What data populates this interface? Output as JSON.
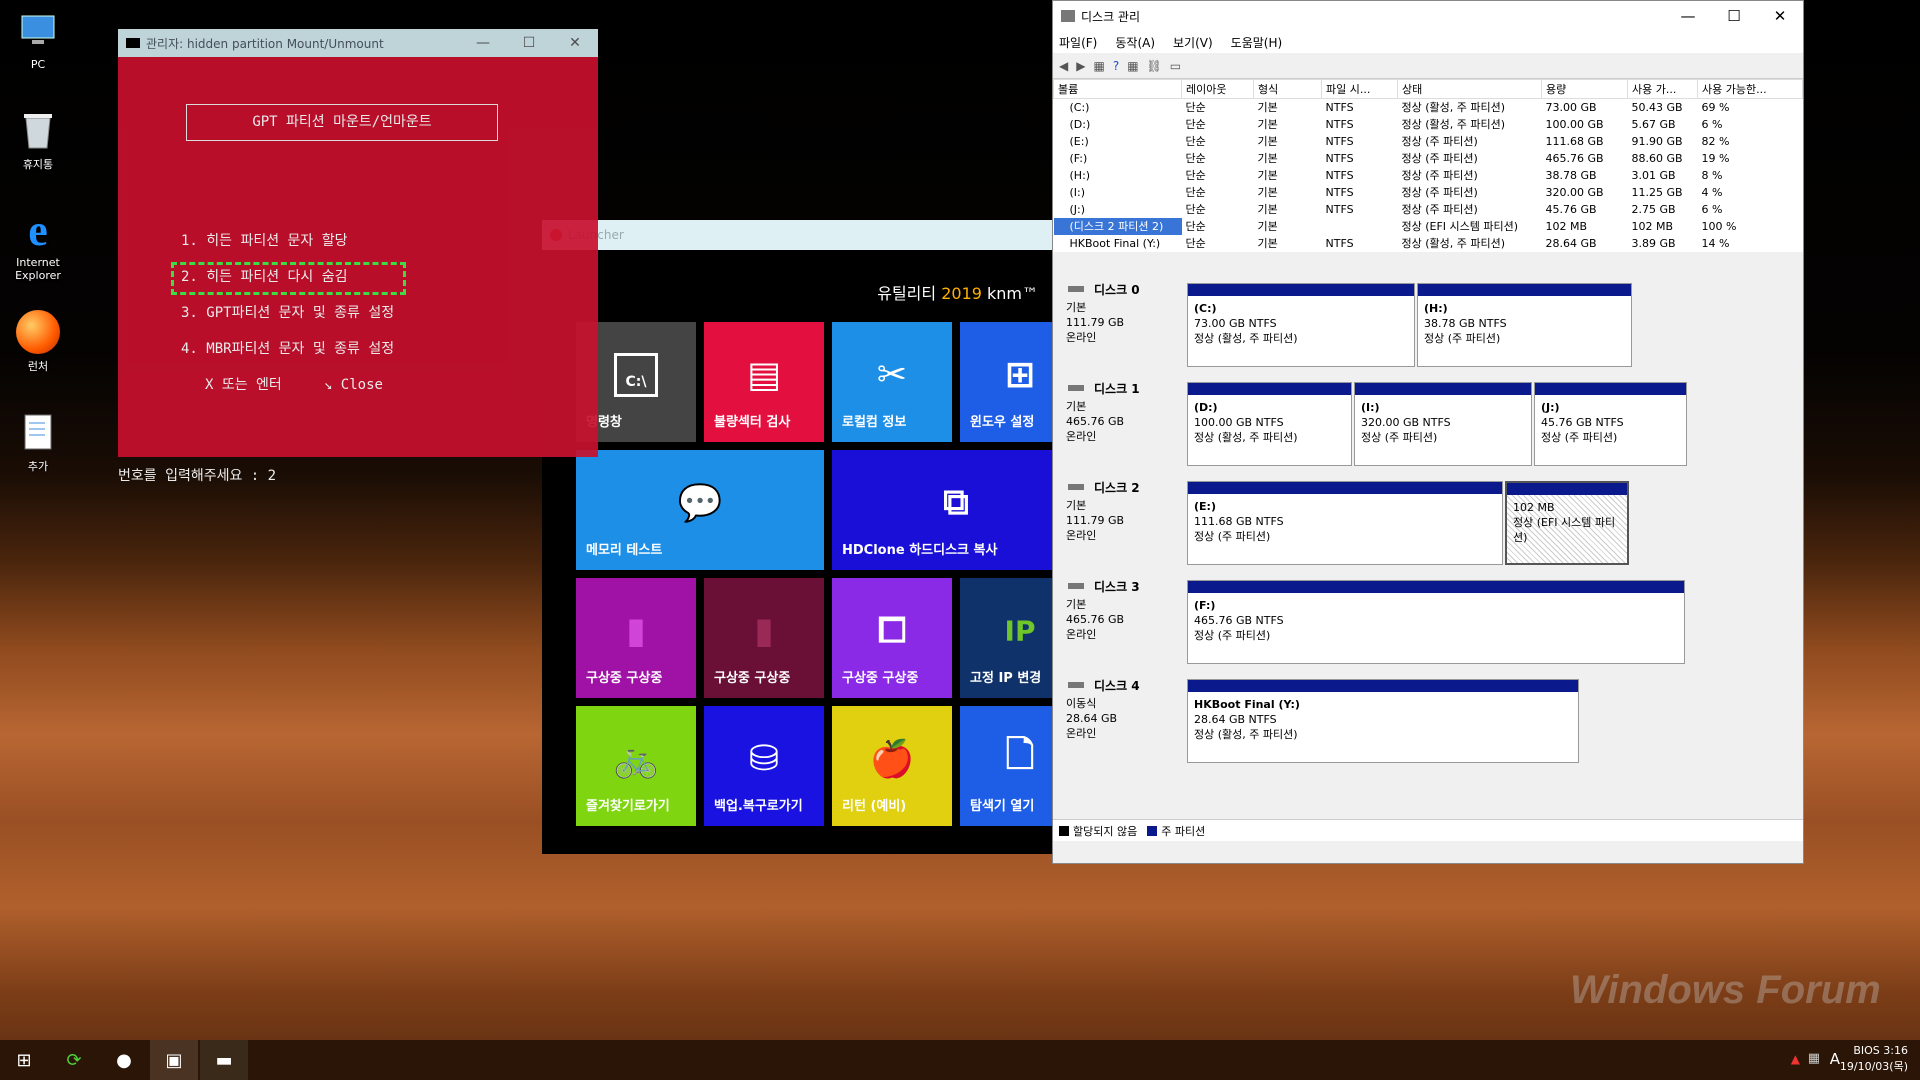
{
  "desktop": {
    "icons": [
      {
        "label": "PC"
      },
      {
        "label": "휴지통"
      },
      {
        "label": "Internet Explorer"
      },
      {
        "label": "런처"
      },
      {
        "label": "추가"
      }
    ]
  },
  "cmd": {
    "title": "관리자:  hidden partition Mount/Unmount",
    "heading": "GPT 파티션 마운트/언마운트",
    "items": [
      "1. 히든 파티션 문자 할당",
      "2. 히든 파티션 다시 숨김",
      "3. GPT파티션 문자 및 종류 설정",
      "4. MBR파티션 문자 및 종류 설정",
      "X 또는 엔터     ↘ Close"
    ],
    "prompt": "번호를 입력해주세요 : 2"
  },
  "launcher": {
    "title": "Launcher",
    "header_prefix": "유틸리티 ",
    "header_year": "2019",
    "header_suffix": " knm™",
    "tiles": [
      "명령창",
      "불량섹터 검사",
      "로컬컴 정보",
      "윈도우 설정",
      "메모리 테스트",
      "HDClone 하드디스크 복사",
      "구상중 구상중",
      "구상중 구상중",
      "구상중 구상중",
      "고정 IP 변경",
      "즐겨찾기로가기",
      "백업.복구로가기",
      "리턴 (예비)",
      "탐색기 열기"
    ]
  },
  "diskmgmt": {
    "title": "디스크 관리",
    "menu": [
      "파일(F)",
      "동작(A)",
      "보기(V)",
      "도움말(H)"
    ],
    "columns": [
      "볼륨",
      "레이아웃",
      "형식",
      "파일 시...",
      "상태",
      "용량",
      "사용 가...",
      "사용 가능한..."
    ],
    "volumes": [
      [
        "(C:)",
        "단순",
        "기본",
        "NTFS",
        "정상 (활성, 주 파티션)",
        "73.00 GB",
        "50.43 GB",
        "69 %"
      ],
      [
        "(D:)",
        "단순",
        "기본",
        "NTFS",
        "정상 (활성, 주 파티션)",
        "100.00 GB",
        "5.67 GB",
        "6 %"
      ],
      [
        "(E:)",
        "단순",
        "기본",
        "NTFS",
        "정상 (주 파티션)",
        "111.68 GB",
        "91.90 GB",
        "82 %"
      ],
      [
        "(F:)",
        "단순",
        "기본",
        "NTFS",
        "정상 (주 파티션)",
        "465.76 GB",
        "88.60 GB",
        "19 %"
      ],
      [
        "(H:)",
        "단순",
        "기본",
        "NTFS",
        "정상 (주 파티션)",
        "38.78 GB",
        "3.01 GB",
        "8 %"
      ],
      [
        "(I:)",
        "단순",
        "기본",
        "NTFS",
        "정상 (주 파티션)",
        "320.00 GB",
        "11.25 GB",
        "4 %"
      ],
      [
        "(J:)",
        "단순",
        "기본",
        "NTFS",
        "정상 (주 파티션)",
        "45.76 GB",
        "2.75 GB",
        "6 %"
      ],
      [
        "(디스크 2 파티션 2)",
        "단순",
        "기본",
        "",
        "정상 (EFI 시스템 파티션)",
        "102 MB",
        "102 MB",
        "100 %"
      ],
      [
        "HKBoot Final (Y:)",
        "단순",
        "기본",
        "NTFS",
        "정상 (활성, 주 파티션)",
        "28.64 GB",
        "3.89 GB",
        "14 %"
      ]
    ],
    "disks": [
      {
        "name": "디스크 0",
        "type": "기본",
        "size": "111.79 GB",
        "status": "온라인",
        "parts": [
          {
            "n": "(C:)",
            "s": "73.00 GB NTFS",
            "st": "정상 (활성, 주 파티션)"
          },
          {
            "n": "(H:)",
            "s": "38.78 GB NTFS",
            "st": "정상 (주 파티션)"
          }
        ]
      },
      {
        "name": "디스크 1",
        "type": "기본",
        "size": "465.76 GB",
        "status": "온라인",
        "parts": [
          {
            "n": "(D:)",
            "s": "100.00 GB NTFS",
            "st": "정상 (활성, 주 파티션)"
          },
          {
            "n": "(I:)",
            "s": "320.00 GB NTFS",
            "st": "정상 (주 파티션)"
          },
          {
            "n": "(J:)",
            "s": "45.76 GB NTFS",
            "st": "정상 (주 파티션)"
          }
        ]
      },
      {
        "name": "디스크 2",
        "type": "기본",
        "size": "111.79 GB",
        "status": "온라인",
        "parts": [
          {
            "n": "(E:)",
            "s": "111.68 GB NTFS",
            "st": "정상 (주 파티션)"
          },
          {
            "n": "",
            "s": "102 MB",
            "st": "정상 (EFI 시스템 파티션)"
          }
        ]
      },
      {
        "name": "디스크 3",
        "type": "기본",
        "size": "465.76 GB",
        "status": "온라인",
        "parts": [
          {
            "n": "(F:)",
            "s": "465.76 GB NTFS",
            "st": "정상 (주 파티션)"
          }
        ]
      },
      {
        "name": "디스크 4",
        "type": "이동식",
        "size": "28.64 GB",
        "status": "온라인",
        "parts": [
          {
            "n": "HKBoot Final  (Y:)",
            "s": "28.64 GB NTFS",
            "st": "정상 (활성, 주 파티션)"
          }
        ]
      }
    ],
    "legend": [
      "할당되지 않음",
      "주 파티션"
    ]
  },
  "taskbar": {
    "clock_line1": "BIOS  3:16",
    "clock_line2": "19/10/03(목)",
    "lang": "A"
  },
  "watermark": "Windows Forum"
}
